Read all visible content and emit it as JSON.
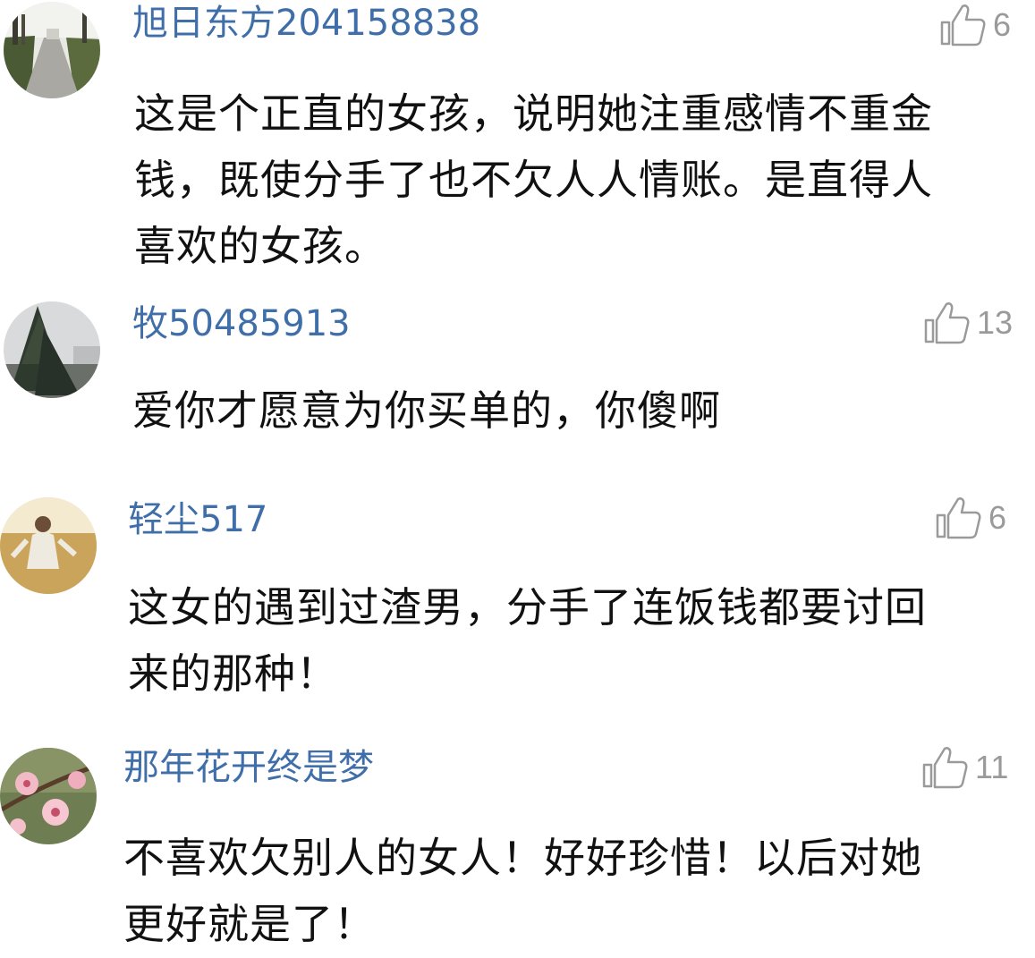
{
  "colors": {
    "username": "#3f6ea8",
    "text": "#111111",
    "like_icon": "#9a9a9a",
    "like_count": "#9a9a9a"
  },
  "comments": [
    {
      "username": "旭日东方204158838",
      "likes": "6",
      "like_icon": "thumbs-up-icon",
      "avatar": "road-landscape-avatar",
      "lines": [
        "这是个正直的女孩，说明她注重感情不重金",
        "钱，既使分手了也不欠人人情账。是直得人",
        "喜欢的女孩。"
      ]
    },
    {
      "username": "牧50485913",
      "likes": "13",
      "like_icon": "thumbs-up-icon",
      "avatar": "pine-tree-avatar",
      "lines": [
        "爱你才愿意为你买单的，你傻啊"
      ]
    },
    {
      "username": "轻尘517",
      "likes": "6",
      "like_icon": "thumbs-up-icon",
      "avatar": "wheat-field-avatar",
      "lines": [
        "这女的遇到过渣男，分手了连饭钱都要讨回",
        "来的那种！"
      ]
    },
    {
      "username": "那年花开终是梦",
      "likes": "11",
      "like_icon": "thumbs-up-icon",
      "avatar": "blossom-avatar",
      "lines": [
        "不喜欢欠别人的女人！好好珍惜！以后对她",
        "更好就是了！"
      ]
    }
  ]
}
